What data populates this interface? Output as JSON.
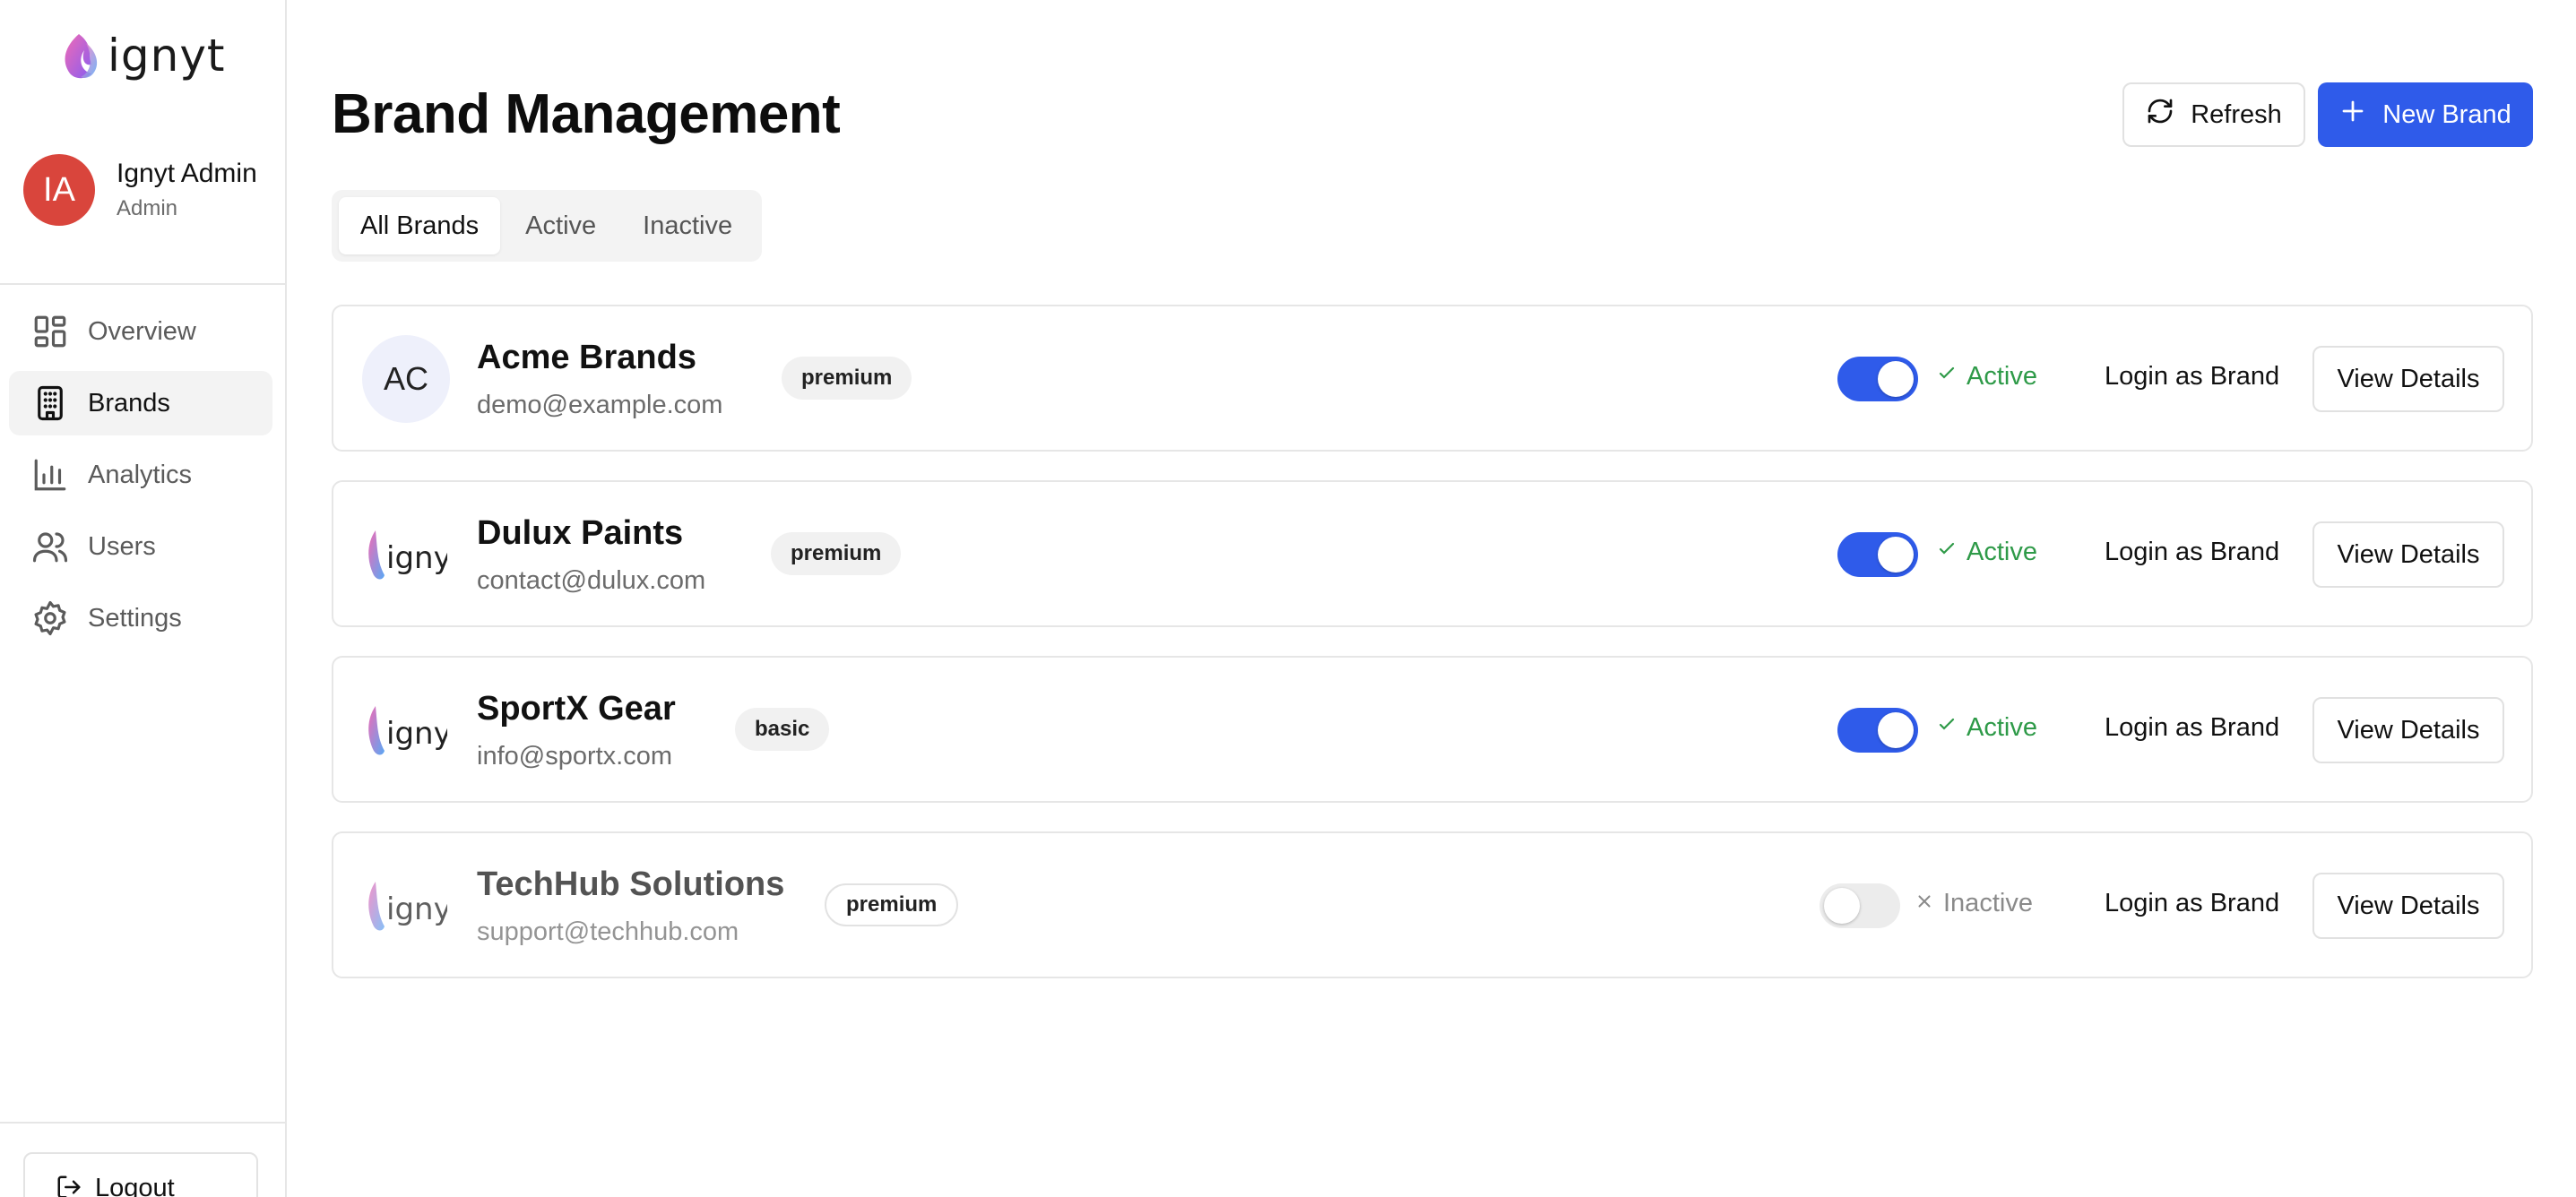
{
  "app": {
    "logo_text": "ignyt"
  },
  "user": {
    "initials": "IA",
    "name": "Ignyt Admin",
    "role": "Admin"
  },
  "sidebar": {
    "items": [
      {
        "label": "Overview",
        "icon": "grid-icon"
      },
      {
        "label": "Brands",
        "icon": "building-icon",
        "active": true
      },
      {
        "label": "Analytics",
        "icon": "bar-chart-icon"
      },
      {
        "label": "Users",
        "icon": "users-icon"
      },
      {
        "label": "Settings",
        "icon": "gear-icon"
      }
    ],
    "logout_label": "Logout"
  },
  "header": {
    "title": "Brand Management",
    "refresh_label": "Refresh",
    "new_label": "New Brand"
  },
  "tabs": [
    {
      "label": "All Brands",
      "active": true
    },
    {
      "label": "Active"
    },
    {
      "label": "Inactive"
    }
  ],
  "brands": [
    {
      "logo": "AC",
      "name": "Acme Brands",
      "email": "demo@example.com",
      "plan": "premium",
      "status": "Active",
      "enabled": true,
      "login_label": "Login as Brand",
      "details_label": "View Details"
    },
    {
      "logo": "ignyt-logo",
      "name": "Dulux Paints",
      "email": "contact@dulux.com",
      "plan": "premium",
      "status": "Active",
      "enabled": true,
      "login_label": "Login as Brand",
      "details_label": "View Details"
    },
    {
      "logo": "ignyt-logo",
      "name": "SportX Gear",
      "email": "info@sportx.com",
      "plan": "basic",
      "status": "Active",
      "enabled": true,
      "login_label": "Login as Brand",
      "details_label": "View Details"
    },
    {
      "logo": "ignyt-logo",
      "name": "TechHub Solutions",
      "email": "support@techhub.com",
      "plan": "premium",
      "status": "Inactive",
      "enabled": false,
      "login_label": "Login as Brand",
      "details_label": "View Details"
    }
  ],
  "colors": {
    "accent": "#2f5bea",
    "active_status": "#2e9a48",
    "avatar": "#d9453c"
  }
}
